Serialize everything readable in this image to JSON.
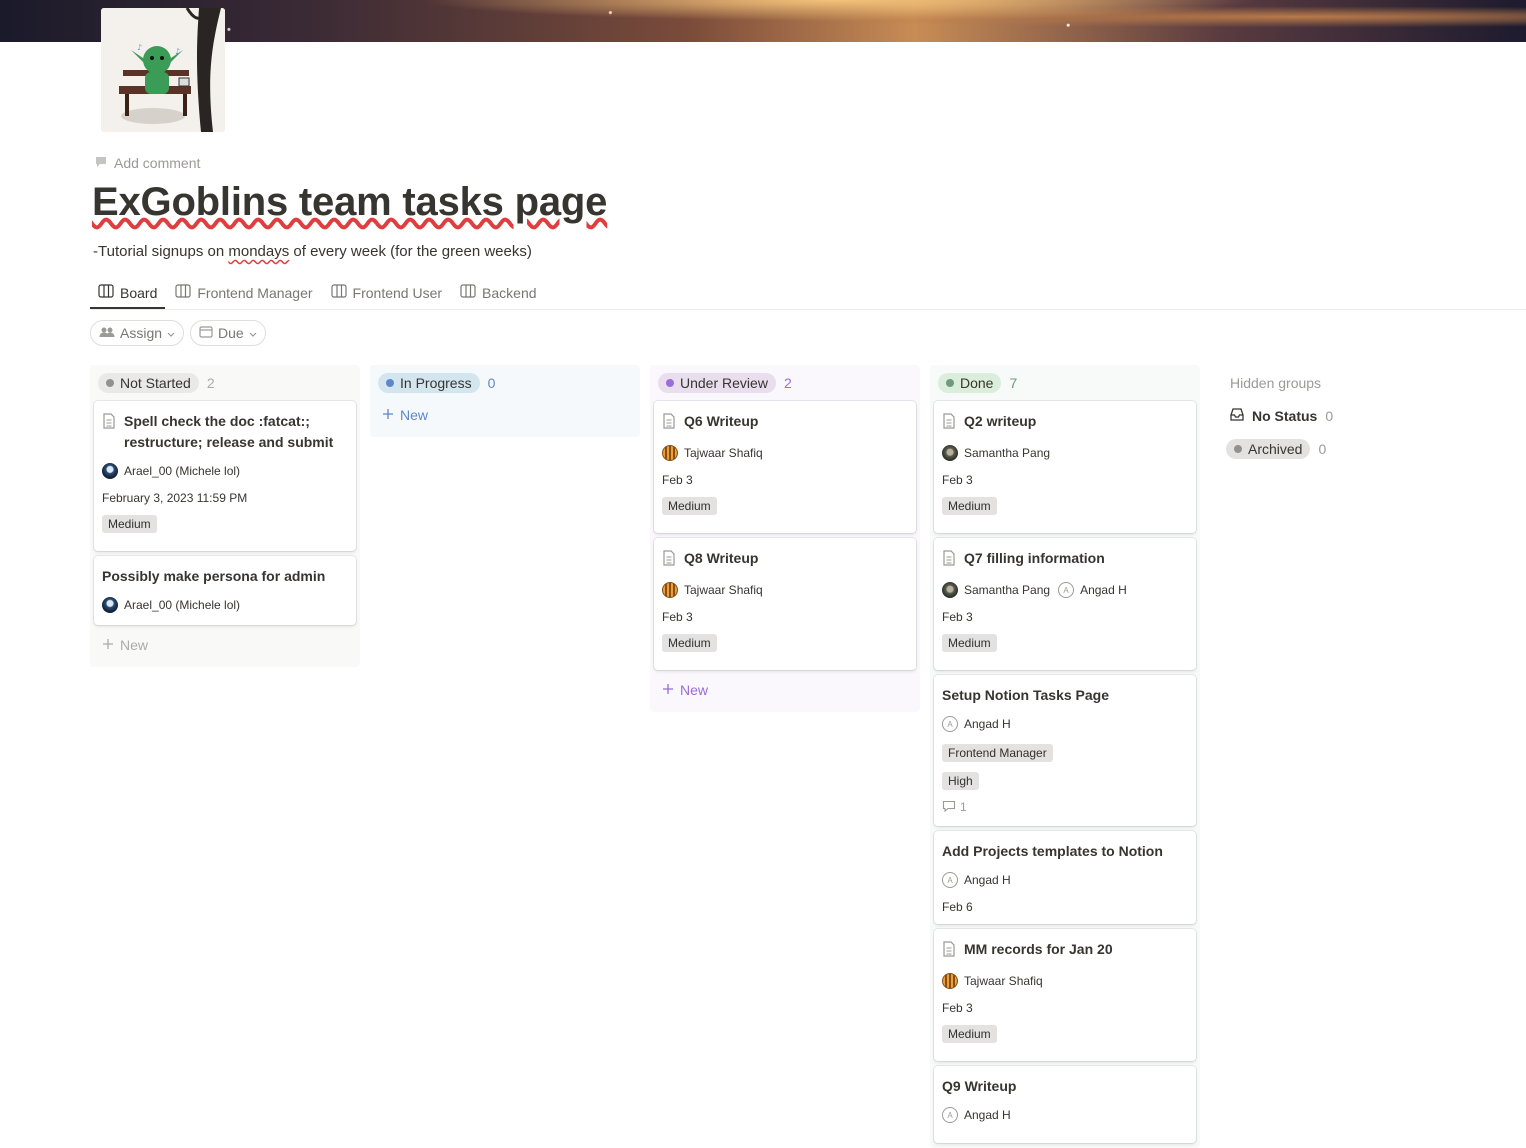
{
  "page": {
    "add_comment": "Add comment",
    "title": "ExGoblins team tasks page",
    "description_prefix": "-Tutorial signups on ",
    "description_marked": "mondays",
    "description_suffix": " of every week (for the green weeks)"
  },
  "tabs": [
    {
      "label": "Board",
      "icon": "board-icon",
      "active": true
    },
    {
      "label": "Frontend Manager",
      "icon": "board-icon"
    },
    {
      "label": "Frontend User",
      "icon": "board-icon"
    },
    {
      "label": "Backend",
      "icon": "board-icon"
    }
  ],
  "filters": {
    "assign": {
      "label": "Assign",
      "icon": "people-icon"
    },
    "due": {
      "label": "Due",
      "icon": "calendar-icon"
    }
  },
  "columns": {
    "not_started": {
      "label": "Not Started",
      "count": "2",
      "color": "#91918e",
      "cards": [
        {
          "title": "Spell check the doc :fatcat:; restructure; release and submit",
          "person": "Arael_00 (Michele lol)",
          "date": "February 3, 2023 11:59 PM",
          "tag": "Medium"
        },
        {
          "title": "Possibly make persona for admin",
          "person": "Arael_00 (Michele lol)"
        }
      ],
      "new_label": "New"
    },
    "in_progress": {
      "label": "In Progress",
      "count": "0",
      "color": "#5e87c9",
      "new_label": "New"
    },
    "under_review": {
      "label": "Under Review",
      "count": "2",
      "color": "#9a6dd7",
      "cards": [
        {
          "title": "Q6 Writeup",
          "person": "Tajwaar Shafiq",
          "date": "Feb 3",
          "tag": "Medium"
        },
        {
          "title": "Q8 Writeup",
          "person": "Tajwaar Shafiq",
          "date": "Feb 3",
          "tag": "Medium"
        }
      ],
      "new_label": "New"
    },
    "done": {
      "label": "Done",
      "count": "7",
      "color": "#6c9b7d",
      "cards": [
        {
          "title": "Q2 writeup",
          "person": "Samantha Pang",
          "date": "Feb 3",
          "tag": "Medium"
        },
        {
          "title": "Q7 filling information",
          "person": "Samantha Pang",
          "person2": "Angad H",
          "date": "Feb 3",
          "tag": "Medium"
        },
        {
          "title": "Setup Notion Tasks Page",
          "person": "Angad H",
          "tag": "Frontend Manager",
          "tag2": "High",
          "comments": "1"
        },
        {
          "title": "Add Projects templates to Notion",
          "person": "Angad H",
          "date": "Feb 6"
        },
        {
          "title": "MM records for Jan 20",
          "person": "Tajwaar Shafiq",
          "date": "Feb 3",
          "tag": "Medium"
        },
        {
          "title": "Q9 Writeup",
          "person": "Angad H"
        }
      ]
    }
  },
  "hidden_groups": {
    "title": "Hidden groups",
    "no_status": {
      "label": "No Status",
      "count": "0"
    },
    "archived": {
      "label": "Archived",
      "count": "0"
    }
  }
}
